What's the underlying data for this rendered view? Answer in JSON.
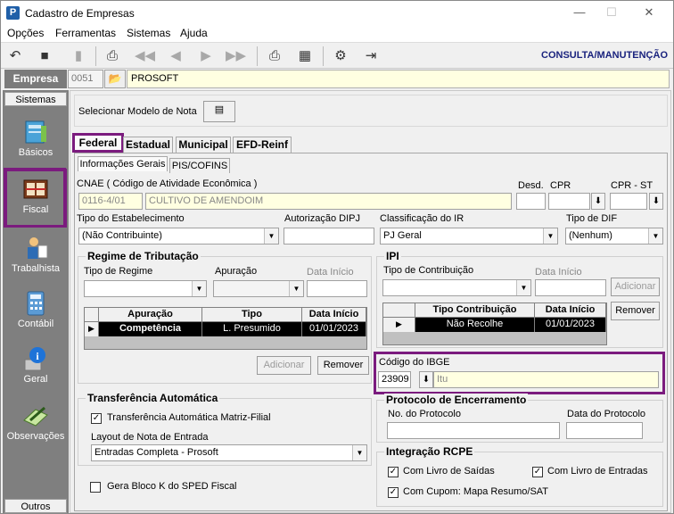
{
  "window": {
    "title": "Cadastro de Empresas",
    "min": "—",
    "max": "☐",
    "close": "✕"
  },
  "menu": [
    "Opções",
    "Ferramentas",
    "Sistemas",
    "Ajuda"
  ],
  "toolbar": {
    "mode": "CONSULTA/MANUTENÇÃO",
    "icons": [
      "undo-icon",
      "save-icon",
      "new-icon",
      "preview-icon",
      "first-icon",
      "prev-icon",
      "next-icon",
      "last-icon",
      "print-icon",
      "calculator-icon",
      "tools-icon",
      "exit-icon"
    ]
  },
  "empresa": {
    "label": "Empresa",
    "code": "0051",
    "name": "PROSOFT"
  },
  "sidebar": {
    "header": "Sistemas",
    "footer": "Outros",
    "items": [
      {
        "label": "Básicos",
        "icon": "book-icon"
      },
      {
        "label": "Fiscal",
        "icon": "ledger-icon"
      },
      {
        "label": "Trabalhista",
        "icon": "worker-icon"
      },
      {
        "label": "Contábil",
        "icon": "calculator-icon"
      },
      {
        "label": "Geral",
        "icon": "info-icon"
      },
      {
        "label": "Observações",
        "icon": "notepad-icon"
      }
    ]
  },
  "main": {
    "model_label": "Selecionar Modelo de Nota",
    "tabs": [
      "Federal",
      "Estadual",
      "Municipal",
      "EFD-Reinf"
    ],
    "subtabs": [
      "Informações Gerais",
      "PIS/COFINS"
    ],
    "cnae": {
      "label": "CNAE ( Código de  Atividade Econômica )",
      "code": "0116-4/01",
      "description": "CULTIVO DE AMENDOIM"
    },
    "desd_label": "Desd.",
    "cpr_label": "CPR",
    "cprst_label": "CPR - ST",
    "tipo_estab": {
      "label": "Tipo do Estabelecimento",
      "value": "(Não Contribuinte)"
    },
    "aut_dipj": {
      "label": "Autorização DIPJ",
      "value": ""
    },
    "class_ir": {
      "label": "Classificação do IR",
      "value": "PJ Geral"
    },
    "tipo_dif": {
      "label": "Tipo de DIF",
      "value": "(Nenhum)"
    },
    "regime": {
      "title": "Regime de Tributação",
      "tipo_label": "Tipo de Regime",
      "apuracao_label": "Apuração",
      "data_inicio_label": "Data Início",
      "columns": [
        "Apuração",
        "Tipo",
        "Data Início"
      ],
      "rows": [
        [
          "Competência",
          "L. Presumido",
          "01/01/2023"
        ]
      ],
      "add": "Adicionar",
      "remove": "Remover"
    },
    "ipi": {
      "title": "IPI",
      "tipo_label": "Tipo de Contribuição",
      "data_inicio_label": "Data Início",
      "columns": [
        "Tipo Contribuição",
        "Data Início"
      ],
      "rows": [
        [
          "Não Recolhe",
          "01/01/2023"
        ]
      ],
      "add": "Adicionar",
      "remove": "Remover"
    },
    "ibge": {
      "label": "Código do IBGE",
      "code": "23909",
      "city": "Itu"
    },
    "transfer": {
      "title": "Transferência Automática",
      "check_label": "Transferência Automática Matriz-Filial",
      "layout_label": "Layout de Nota de Entrada",
      "layout_value": "Entradas Completa - Prosoft"
    },
    "bloco_k": "Gera Bloco K do SPED Fiscal",
    "protocolo": {
      "title": "Protocolo de Encerramento",
      "num_label": "No. do Protocolo",
      "date_label": "Data do Protocolo"
    },
    "rcpe": {
      "title": "Integração RCPE",
      "saidas": "Com Livro de Saídas",
      "entradas": "Com Livro de Entradas",
      "cupom": "Com Cupom: Mapa Resumo/SAT"
    }
  }
}
